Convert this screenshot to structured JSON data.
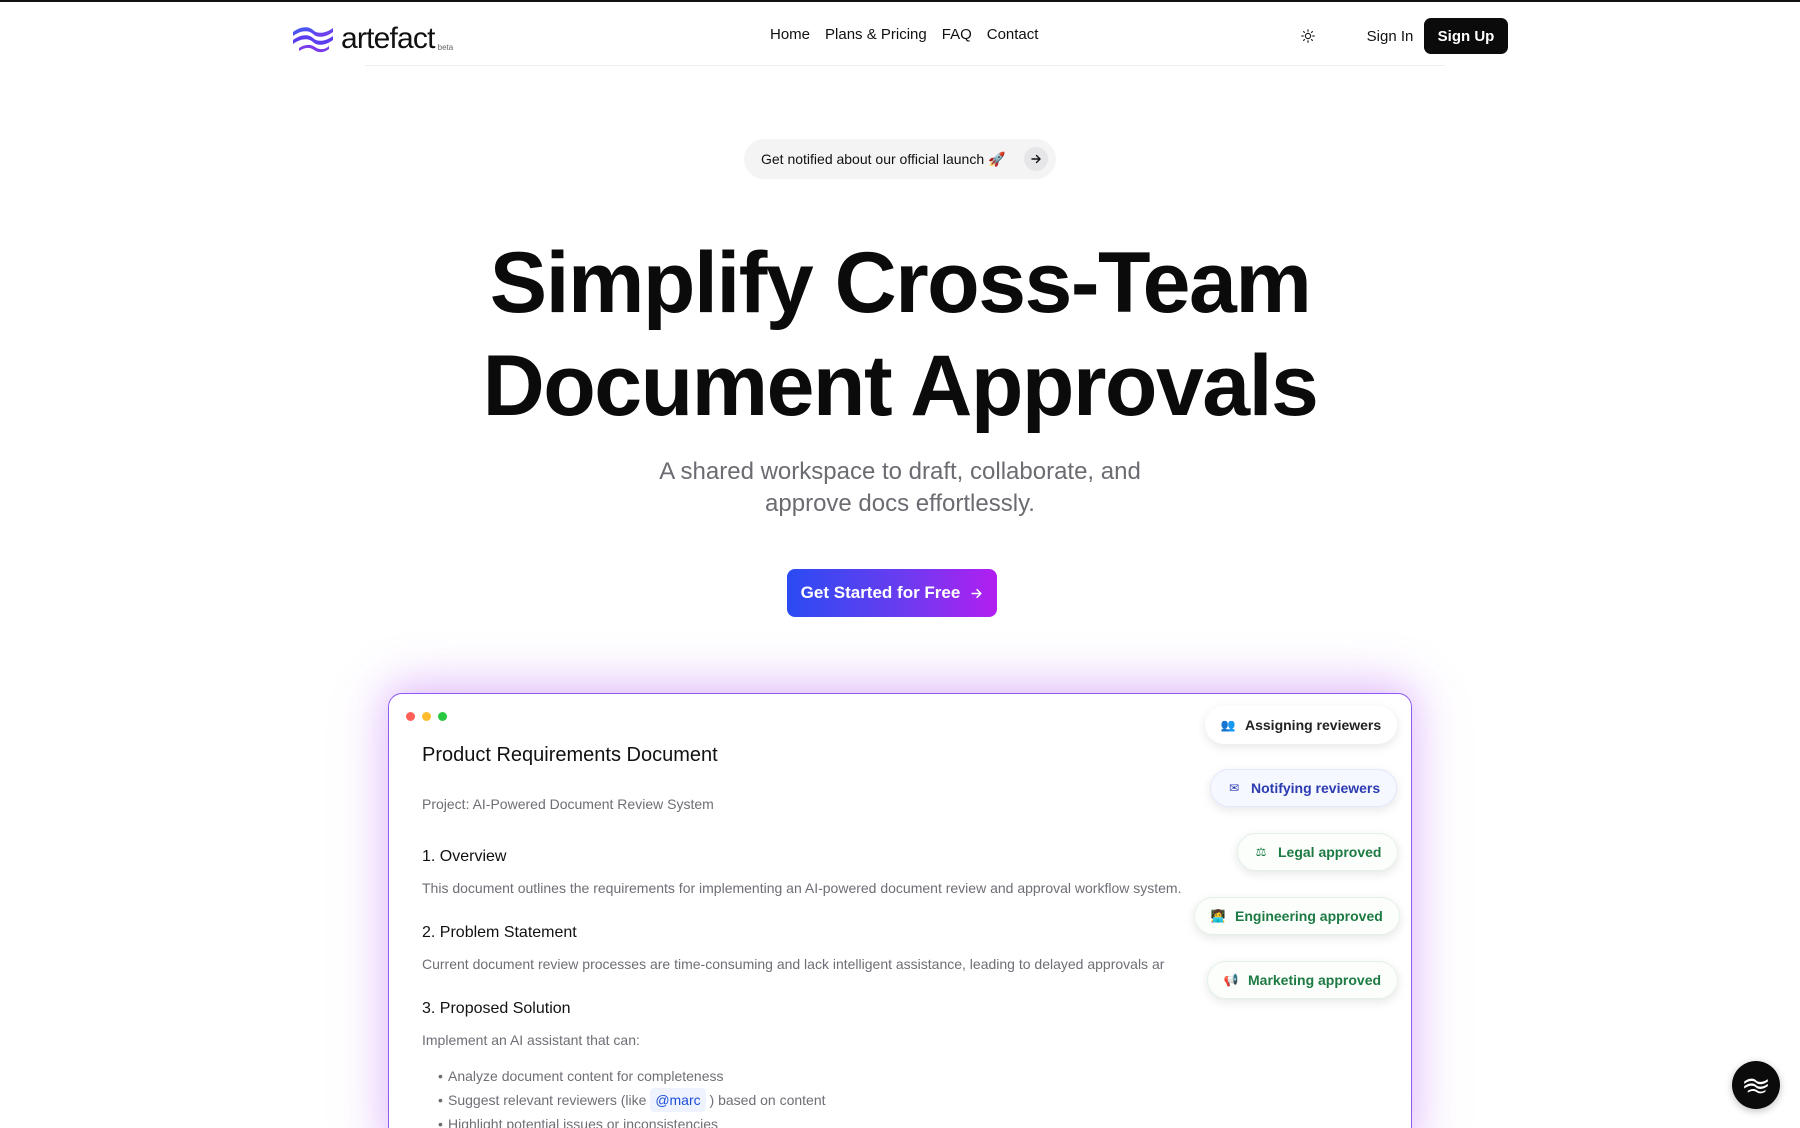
{
  "brand": {
    "name": "artefact",
    "tag": "beta",
    "colors": {
      "primary": "#4f46e5",
      "accent": "#7c3aed"
    }
  },
  "nav": {
    "links": [
      "Home",
      "Plans & Pricing",
      "FAQ",
      "Contact"
    ],
    "theme_icon": "sun-icon",
    "sign_in": "Sign In",
    "sign_up": "Sign Up"
  },
  "announcement": {
    "text": "Get notified about our official launch 🚀",
    "icon": "arrow-right-icon"
  },
  "hero": {
    "title_line1": "Simplify Cross-Team",
    "title_line2": "Document Approvals",
    "subtitle_line1": "A shared workspace to draft, collaborate, and",
    "subtitle_line2": "approve docs effortlessly.",
    "cta": "Get Started for Free"
  },
  "document": {
    "title": "Product Requirements Document",
    "project": "Project: AI-Powered Document Review System",
    "sections": [
      {
        "heading": "1. Overview",
        "body": "This document outlines the requirements for implementing an AI-powered document review and approval workflow system."
      },
      {
        "heading": "2. Problem Statement",
        "body": "Current document review processes are time-consuming and lack intelligent assistance, leading to delayed approvals ar"
      },
      {
        "heading": "3. Proposed Solution",
        "body": "Implement an AI assistant that can:"
      }
    ],
    "bullets": {
      "b1": "Analyze document content for completeness",
      "b2_pre": "Suggest relevant reviewers (like ",
      "b2_mention": "@marc",
      "b2_post": " ) based on content",
      "b3": "Highlight potential issues or inconsistencies"
    }
  },
  "status_badges": [
    {
      "label": "Assigning reviewers",
      "icon": "people-icon"
    },
    {
      "label": "Notifying reviewers",
      "icon": "mail-icon"
    },
    {
      "label": "Legal approved",
      "icon": "scales-icon"
    },
    {
      "label": "Engineering approved",
      "icon": "technologist-icon"
    },
    {
      "label": "Marketing approved",
      "icon": "megaphone-icon"
    }
  ],
  "window_dots": [
    "#ff5f57",
    "#febc2e",
    "#28c840"
  ],
  "chat_button": {
    "icon": "artefact-logo-icon"
  }
}
